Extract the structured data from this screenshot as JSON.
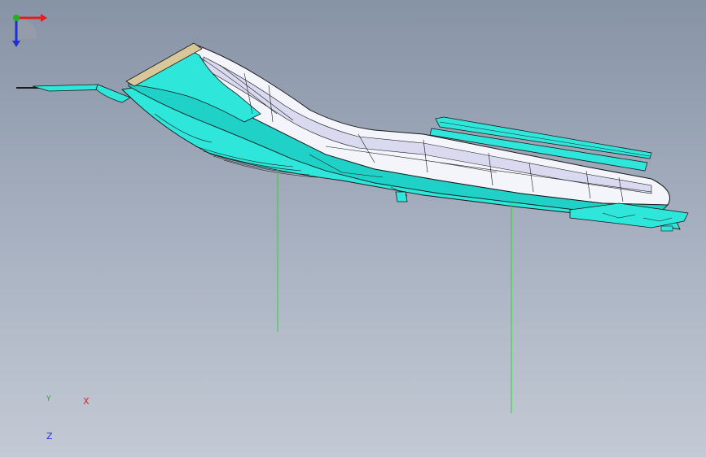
{
  "viewport": {
    "background_top": "#8793a6",
    "background_bottom": "#c3cad5"
  },
  "model": {
    "colors": {
      "body_white": "#f4f4fb",
      "body_shade": "#d9daf0",
      "cyan": "#2ee6da",
      "cyan_dark": "#1bb7ad",
      "edge": "#1a1a1a",
      "tan": "#d8c79a",
      "reference_line": "#2fd03b"
    }
  },
  "triad": {
    "x_label": "X",
    "y_label": "Y",
    "z_label": "Z",
    "x_color": "#e02020",
    "y_color": "#20b020",
    "z_color": "#2030d0"
  }
}
